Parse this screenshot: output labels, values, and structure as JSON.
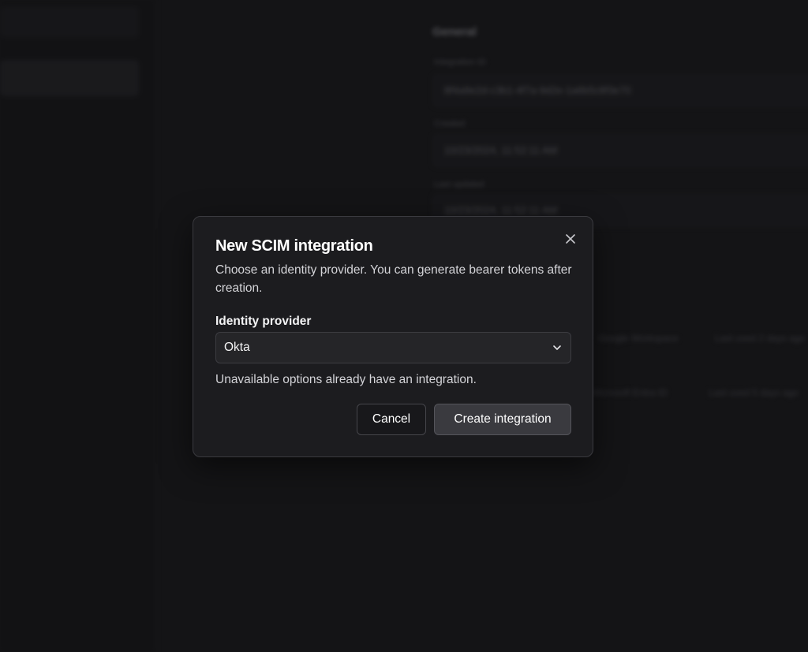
{
  "background": {
    "section_title": "General",
    "fields": [
      {
        "label": "Integration ID",
        "value": "8f4a9e2d-c3b1-4f7a-9d2e-1a6b5c8f3e70"
      },
      {
        "label": "Created",
        "value": "10/23/2024, 11:52:11 AM"
      },
      {
        "label": "Last updated",
        "value": "10/23/2024, 11:52:11 AM"
      }
    ],
    "rows": [
      {
        "col1": "Google Workspace",
        "col2": "Last used 2 days ago"
      },
      {
        "col1": "Microsoft Entra ID",
        "col2": "Last used 5 days ago"
      }
    ]
  },
  "dialog": {
    "title": "New SCIM integration",
    "description": "Choose an identity provider. You can generate bearer tokens after creation.",
    "field_label": "Identity provider",
    "selected_provider": "Okta",
    "helper_text": "Unavailable options already have an integration.",
    "cancel_label": "Cancel",
    "create_label": "Create integration",
    "close_icon": "close-icon",
    "select_icon": "chevron-down-icon"
  }
}
